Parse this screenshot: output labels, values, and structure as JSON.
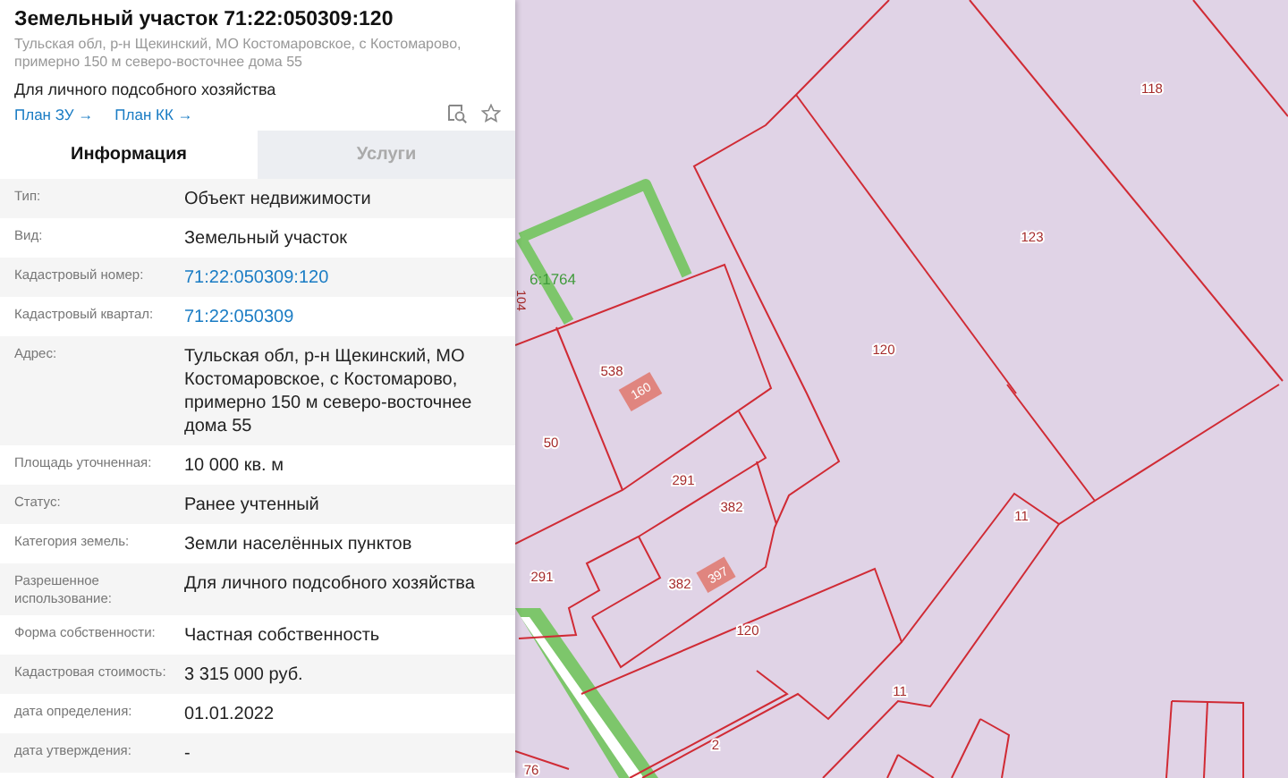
{
  "header": {
    "title": "Земельный участок 71:22:050309:120",
    "address": "Тульская обл, р-н Щекинский, МО Костомаровское, с Костомарово, примерно 150 м северо-восточнее дома 55",
    "purpose": "Для личного подсобного хозяйства",
    "links": [
      "План ЗУ →",
      "План КК →"
    ]
  },
  "tabs": [
    {
      "label": "Информация",
      "selected": true
    },
    {
      "label": "Услуги",
      "selected": false
    }
  ],
  "rows": [
    {
      "label": "Тип:",
      "value": "Объект недвижимости",
      "kind": "text"
    },
    {
      "label": "Вид:",
      "value": "Земельный участок",
      "kind": "text"
    },
    {
      "label": "Кадастровый номер:",
      "value": "71:22:050309:120",
      "kind": "link"
    },
    {
      "label": "Кадастровый квартал:",
      "value": "71:22:050309",
      "kind": "link"
    },
    {
      "label": "Адрес:",
      "value": "Тульская обл, р-н Щекинский, МО Костомаровское, с Костомарово, примерно 150 м северо-восточнее дома 55",
      "kind": "text"
    },
    {
      "label": "Площадь уточненная:",
      "value": "10 000 кв. м",
      "kind": "text"
    },
    {
      "label": "Статус:",
      "value": "Ранее учтенный",
      "kind": "text"
    },
    {
      "label": "Категория земель:",
      "value": "Земли населённых пунктов",
      "kind": "text"
    },
    {
      "label": "Разрешенное использование:",
      "value": "Для личного подсобного хозяйства",
      "kind": "text"
    },
    {
      "label": "Форма собственности:",
      "value": "Частная собственность",
      "kind": "text"
    },
    {
      "label": "Кадастровая стоимость:",
      "value": "3 315 000 руб.",
      "kind": "text"
    },
    {
      "label": "дата определения:",
      "value": "01.01.2022",
      "kind": "text"
    },
    {
      "label": "дата утверждения:",
      "value": "-",
      "kind": "text"
    }
  ],
  "map": {
    "labels": [
      {
        "text": "118",
        "kind": "parcel"
      },
      {
        "text": "123",
        "kind": "parcel"
      },
      {
        "text": "120",
        "kind": "parcel"
      },
      {
        "text": "6:1764",
        "kind": "road"
      },
      {
        "text": "104",
        "kind": "vertical"
      },
      {
        "text": "538",
        "kind": "parcel"
      },
      {
        "text": "160",
        "kind": "building"
      },
      {
        "text": "50",
        "kind": "parcel"
      },
      {
        "text": "291",
        "kind": "parcel"
      },
      {
        "text": "382",
        "kind": "parcel"
      },
      {
        "text": "291",
        "kind": "parcel"
      },
      {
        "text": "382",
        "kind": "parcel"
      },
      {
        "text": "397",
        "kind": "building"
      },
      {
        "text": "120",
        "kind": "parcel"
      },
      {
        "text": "11",
        "kind": "parcel"
      },
      {
        "text": "11",
        "kind": "parcel"
      },
      {
        "text": "2",
        "kind": "parcel"
      },
      {
        "text": "76",
        "kind": "parcel"
      }
    ]
  }
}
